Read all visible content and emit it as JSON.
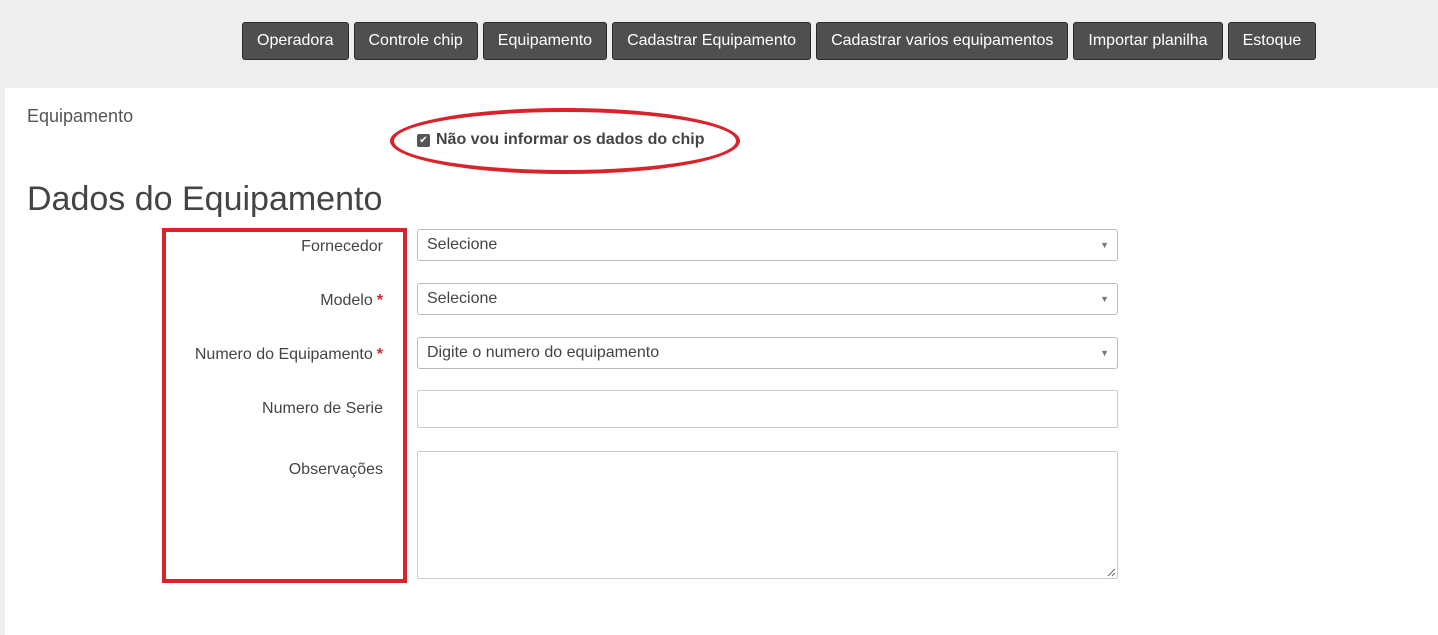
{
  "nav": {
    "items": [
      {
        "label": "Operadora"
      },
      {
        "label": "Controle chip"
      },
      {
        "label": "Equipamento"
      },
      {
        "label": "Cadastrar Equipamento"
      },
      {
        "label": "Cadastrar varios equipamentos"
      },
      {
        "label": "Importar planilha"
      },
      {
        "label": "Estoque"
      }
    ]
  },
  "breadcrumb": "Equipamento",
  "chip_option": {
    "label": "Não vou informar os dados do chip",
    "checked": true
  },
  "section_title": "Dados do Equipamento",
  "form": {
    "fornecedor": {
      "label": "Fornecedor",
      "value": "Selecione"
    },
    "modelo": {
      "label": "Modelo",
      "required_mark": "*",
      "value": "Selecione"
    },
    "numero_equipamento": {
      "label": "Numero do Equipamento",
      "required_mark": "*",
      "placeholder": "Digite o numero do equipamento"
    },
    "numero_serie": {
      "label": "Numero de Serie",
      "value": ""
    },
    "observacoes": {
      "label": "Observações",
      "value": ""
    }
  },
  "colors": {
    "nav_button": "#4f4f4f",
    "highlight_red": "#d9232a",
    "required_red": "#d9232a"
  }
}
